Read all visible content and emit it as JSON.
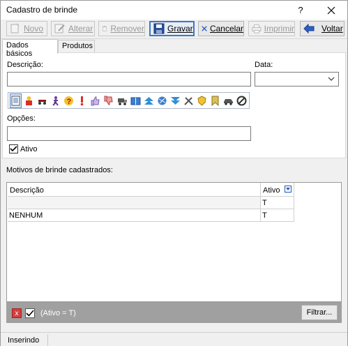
{
  "window": {
    "title": "Cadastro de  brinde",
    "help": "?"
  },
  "toolbar": {
    "novo": "Novo",
    "alterar": "Alterar",
    "remover": "Remover",
    "gravar": "Gravar",
    "cancelar": "Cancelar",
    "imprimir": "Imprimir",
    "voltar": "Voltar"
  },
  "tabs": [
    {
      "label": "Dados básicos"
    },
    {
      "label": "Produtos"
    }
  ],
  "form": {
    "descricao_label": "Descrição:",
    "descricao_value": "",
    "data_label": "Data:",
    "data_value": "",
    "opcoes_label": "Opções:",
    "opcoes_value": "",
    "ativo_label": "Ativo",
    "ativo_checked": true
  },
  "icons": [
    "document",
    "person",
    "cannon",
    "figure",
    "question",
    "exclamation",
    "thumbs-up",
    "thumbs-down",
    "truck",
    "book",
    "arrows-up",
    "globe",
    "arrows-down",
    "tools",
    "badge",
    "bookmark",
    "car",
    "no-sign"
  ],
  "grid": {
    "title": "Motivos de brinde cadastrados:",
    "columns": [
      "Descrição",
      "Ativo"
    ],
    "filter_row": [
      "",
      "T"
    ],
    "rows": [
      [
        "NENHUM",
        "T"
      ]
    ]
  },
  "filter": {
    "text": "(Ativo = T)",
    "button": "Filtrar..."
  },
  "status": {
    "mode": "Inserindo"
  },
  "colors": {
    "accent": "#3c78c8",
    "filterbar": "#a0a0a0",
    "remove": "#d23f3f"
  }
}
